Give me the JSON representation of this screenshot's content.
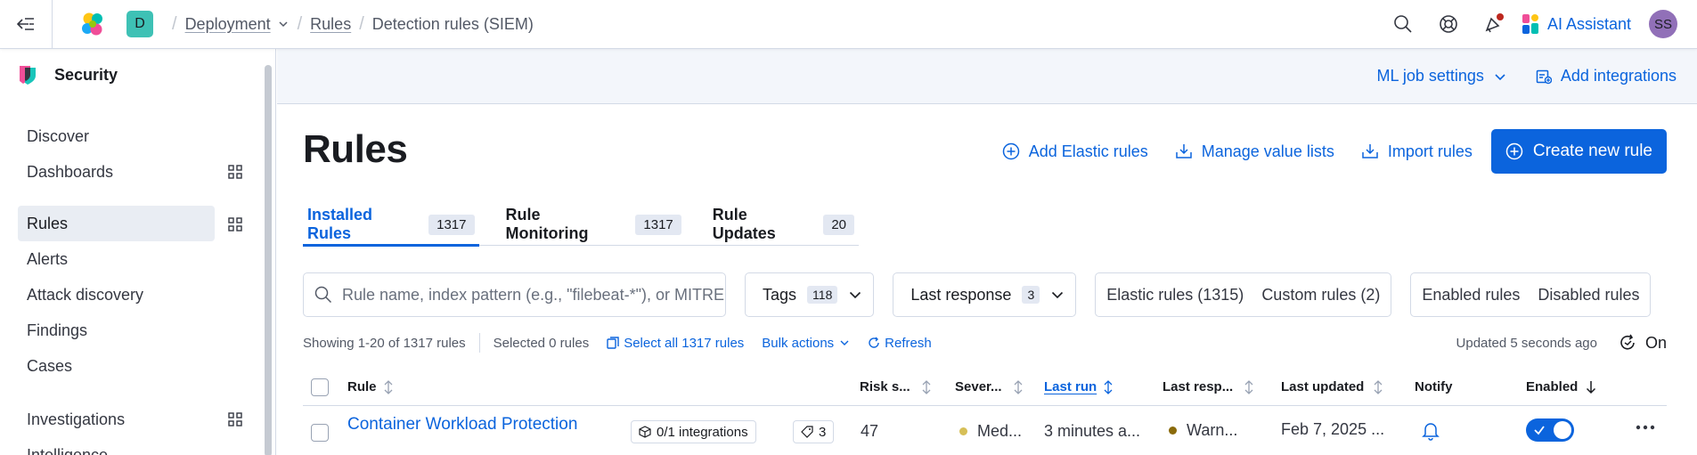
{
  "header": {
    "space_initial": "D",
    "breadcrumbs": [
      "Deployment",
      "Rules",
      "Detection rules (SIEM)"
    ],
    "ai_assistant_label": "AI Assistant",
    "user_initials": "SS"
  },
  "sidebar": {
    "title": "Security",
    "items": [
      {
        "label": "Discover"
      },
      {
        "label": "Dashboards"
      },
      {
        "label": "Rules"
      },
      {
        "label": "Alerts"
      },
      {
        "label": "Attack discovery"
      },
      {
        "label": "Findings"
      },
      {
        "label": "Cases"
      },
      {
        "label": "Investigations"
      },
      {
        "label": "Intelligence"
      }
    ]
  },
  "subheader": {
    "ml_job_settings": "ML job settings",
    "add_integrations": "Add integrations"
  },
  "page": {
    "title": "Rules",
    "add_elastic_rules": "Add Elastic rules",
    "manage_value_lists": "Manage value lists",
    "import_rules": "Import rules",
    "create_new_rule": "Create new rule"
  },
  "tabs": [
    {
      "label": "Installed Rules",
      "count": "1317"
    },
    {
      "label": "Rule Monitoring",
      "count": "1317"
    },
    {
      "label": "Rule Updates",
      "count": "20"
    }
  ],
  "filters": {
    "search_placeholder": "Rule name, index pattern (e.g., \"filebeat-*\"), or MITRE ATT&CK",
    "tags_label": "Tags",
    "tags_count": "118",
    "last_response_label": "Last response",
    "last_response_count": "3",
    "elastic_rules": "Elastic rules (1315)",
    "custom_rules": "Custom rules (2)",
    "enabled_rules": "Enabled rules",
    "disabled_rules": "Disabled rules"
  },
  "utility": {
    "showing": "Showing 1-20 of 1317 rules",
    "selected": "Selected 0 rules",
    "select_all": "Select all 1317 rules",
    "bulk_actions": "Bulk actions",
    "refresh": "Refresh",
    "updated": "Updated 5 seconds ago",
    "auto_refresh": "On"
  },
  "table": {
    "columns": {
      "rule": "Rule",
      "risk_score": "Risk s...",
      "severity": "Sever...",
      "last_run": "Last run",
      "last_response": "Last resp...",
      "last_updated": "Last updated",
      "notify": "Notify",
      "enabled": "Enabled"
    },
    "rows": [
      {
        "rule": "Container Workload Protection",
        "integrations": "0/1 integrations",
        "tags": "3",
        "risk_score": "47",
        "severity": "Med...",
        "severity_color": "#d6bf57",
        "last_run": "3 minutes a...",
        "last_response": "Warn...",
        "last_response_color": "#8a6a0a",
        "last_updated": "Feb 7, 2025 ...",
        "enabled": true
      }
    ]
  },
  "colors": {
    "accent": "#0b64dd",
    "space_avatar": "#3ec1b5",
    "user_avatar": "#9170b8"
  }
}
